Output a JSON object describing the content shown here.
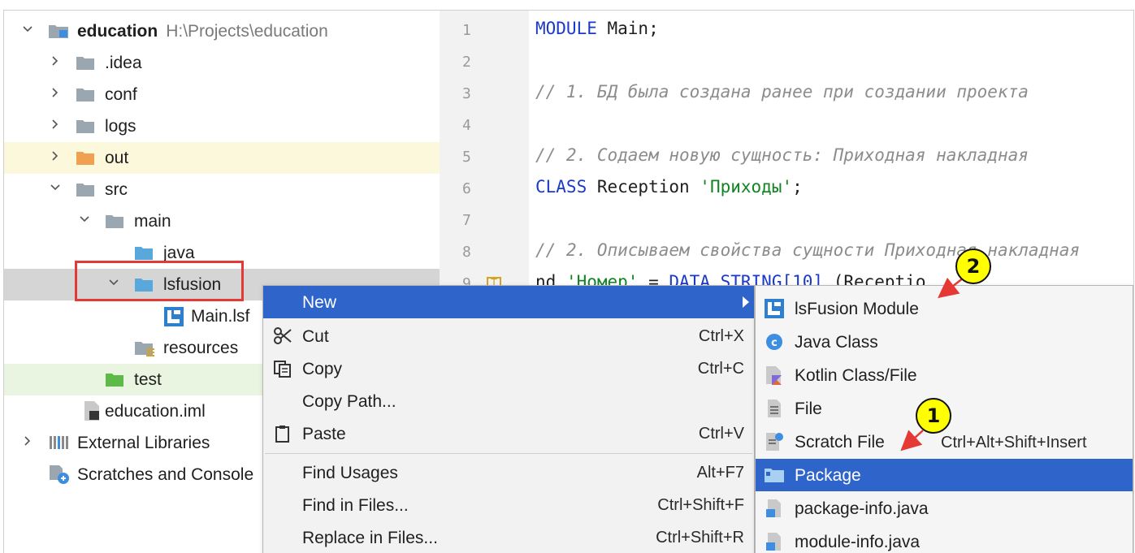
{
  "tree": {
    "items": [
      {
        "label": "education",
        "path": "H:\\Projects\\education"
      },
      {
        "label": ".idea"
      },
      {
        "label": "conf"
      },
      {
        "label": "logs"
      },
      {
        "label": "out"
      },
      {
        "label": "src"
      },
      {
        "label": "main"
      },
      {
        "label": "java"
      },
      {
        "label": "lsfusion"
      },
      {
        "label": "Main.lsf"
      },
      {
        "label": "resources"
      },
      {
        "label": "test"
      },
      {
        "label": "education.iml"
      },
      {
        "label": "External Libraries"
      },
      {
        "label": "Scratches and Console"
      }
    ]
  },
  "editor": {
    "line_numbers": [
      "1",
      "2",
      "3",
      "4",
      "5",
      "6",
      "7",
      "8",
      "9"
    ],
    "line1": {
      "kw": "MODULE",
      "rest": " Main;"
    },
    "line3": "// 1. БД была создана ранее при создании проекта",
    "line5": "// 2. Содаем новую сущность: Приходная накладная",
    "line6": {
      "kw": "CLASS",
      "rest": " Reception ",
      "str": "'Приходы'",
      "end": ";"
    },
    "line8": "// 2. Описываем свойства сущности Приходная накладная",
    "line9": {
      "a": "nd ",
      "str": "'Номер'",
      "b": " = ",
      "kw": "DATA STRING[10]",
      "c": " (Receptio",
      "gutter_mark": "T"
    }
  },
  "context_menu": {
    "new": "New",
    "cut": "Cut",
    "cut_shortcut": "Ctrl+X",
    "copy": "Copy",
    "copy_shortcut": "Ctrl+C",
    "copy_path": "Copy Path...",
    "paste": "Paste",
    "paste_shortcut": "Ctrl+V",
    "find_usages": "Find Usages",
    "find_usages_shortcut": "Alt+F7",
    "find_in_files": "Find in Files...",
    "find_in_files_shortcut": "Ctrl+Shift+F",
    "replace_in_files": "Replace in Files...",
    "replace_in_files_shortcut": "Ctrl+Shift+R"
  },
  "submenu": {
    "lsfusion_module": "lsFusion Module",
    "java_class": "Java Class",
    "kotlin": "Kotlin Class/File",
    "file": "File",
    "scratch": "Scratch File",
    "scratch_shortcut": "Ctrl+Alt+Shift+Insert",
    "package": "Package",
    "package_info": "package-info.java",
    "module_info": "module-info.java"
  },
  "callouts": {
    "one": "1",
    "two": "2"
  },
  "colors": {
    "menu_selection": "#2f65ca",
    "callout_fill": "#ffff00",
    "annotation_red": "#e53935"
  }
}
